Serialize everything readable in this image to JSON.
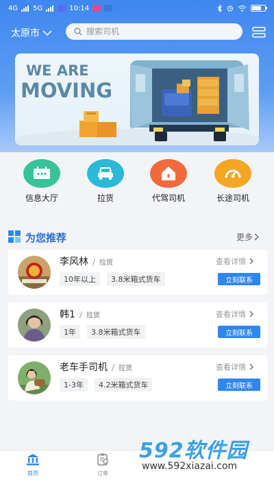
{
  "status_bar": {
    "signal_a": "4G",
    "signal_b": "5G",
    "time": "10:14",
    "battery_level": 0.7
  },
  "header": {
    "city": "太原市",
    "search_placeholder": "搜索司机"
  },
  "banner": {
    "line1": "WE ARE",
    "line2": "MOVING"
  },
  "quick_nav": [
    {
      "label": "信息大厅",
      "color": "#36c39a",
      "icon": "message-board-icon"
    },
    {
      "label": "拉货",
      "color": "#2bb8d9",
      "icon": "truck-icon"
    },
    {
      "label": "代驾司机",
      "color": "#f06a3c",
      "icon": "house-icon"
    },
    {
      "label": "长途司机",
      "color": "#f5a623",
      "icon": "speedometer-icon"
    }
  ],
  "recommend": {
    "title": "为您推荐",
    "more": "更多"
  },
  "drivers": [
    {
      "name": "李风林",
      "type": "拉货",
      "tags": [
        "10年以上",
        "3.8米箱式货车"
      ],
      "detail": "查看详情",
      "contact": "立刻联系"
    },
    {
      "name": "韩1",
      "type": "拉货",
      "tags": [
        "1年",
        "3.8米箱式货车"
      ],
      "detail": "查看详情",
      "contact": "立刻联系"
    },
    {
      "name": "老车手司机",
      "type": "拉货",
      "tags": [
        "1-3年",
        "4.2米箱式货车"
      ],
      "detail": "查看详情",
      "contact": "立刻联系"
    }
  ],
  "tabbar": [
    {
      "label": "首页",
      "active": true
    },
    {
      "label": "订单",
      "active": false
    }
  ],
  "watermark": {
    "brand": "592软件园",
    "url": "www.592xiazai.com"
  }
}
